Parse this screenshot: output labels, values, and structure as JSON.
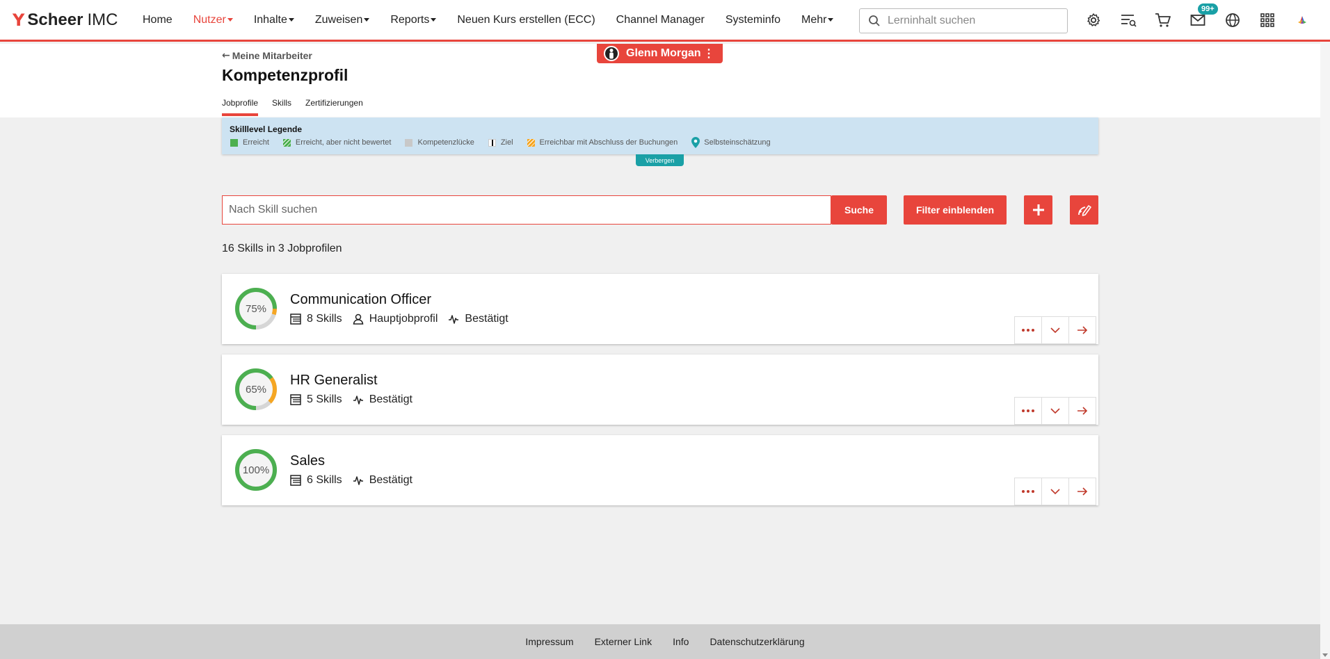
{
  "brand": {
    "mark": "Y",
    "name": "Scheer",
    "suffix": "IMC"
  },
  "nav": [
    {
      "label": "Home",
      "active": false,
      "dropdown": false
    },
    {
      "label": "Nutzer",
      "active": true,
      "dropdown": true
    },
    {
      "label": "Inhalte",
      "active": false,
      "dropdown": true
    },
    {
      "label": "Zuweisen",
      "active": false,
      "dropdown": true
    },
    {
      "label": "Reports",
      "active": false,
      "dropdown": true
    },
    {
      "label": "Neuen Kurs erstellen (ECC)",
      "active": false,
      "dropdown": false
    },
    {
      "label": "Channel Manager",
      "active": false,
      "dropdown": false
    },
    {
      "label": "Systeminfo",
      "active": false,
      "dropdown": false
    },
    {
      "label": "Mehr",
      "active": false,
      "dropdown": true
    }
  ],
  "top_search": {
    "placeholder": "Lerninhalt suchen",
    "value": ""
  },
  "top_icons": [
    "gear-icon",
    "learning-list-icon",
    "cart-icon",
    "mail-icon",
    "globe-icon",
    "apps-grid-icon",
    "colorful-logo-icon"
  ],
  "mail_badge": "99+",
  "header": {
    "back_label": "Meine Mitarbeiter",
    "title": "Kompetenzprofil",
    "tabs": [
      "Jobprofile",
      "Skills",
      "Zertifizierungen"
    ],
    "active_tab": 0,
    "user_name": "Glenn Morgan",
    "user_menu": "⋮"
  },
  "legend": {
    "title": "Skilllevel Legende",
    "items": [
      {
        "label": "Erreicht",
        "color": "#4caf50"
      },
      {
        "label": "Erreicht, aber nicht bewertet",
        "color": "#4caf50"
      },
      {
        "label": "Kompetenzlücke",
        "color": "#c8c8c8"
      },
      {
        "label": "Ziel",
        "color": "#111111"
      },
      {
        "label": "Erreichbar mit Abschluss der Buchungen",
        "color": "#f5a623"
      },
      {
        "label": "Selbsteinschätzung",
        "color": "#1aa0a6"
      }
    ],
    "hide_label": "Verbergen"
  },
  "skill_search": {
    "placeholder": "Nach Skill suchen",
    "value": "",
    "button": "Suche"
  },
  "filter_button": "Filter einblenden",
  "summary": "16 Skills in 3 Jobprofilen",
  "jobprofiles": [
    {
      "title": "Communication Officer",
      "percent": 75,
      "percent_label": "75%",
      "reachable_pct": 5,
      "skills": "8 Skills",
      "main_label": "Hauptjobprofil",
      "status": "Bestätigt"
    },
    {
      "title": "HR Generalist",
      "percent": 65,
      "percent_label": "65%",
      "reachable_pct": 22,
      "skills": "5 Skills",
      "main_label": "",
      "status": "Bestätigt"
    },
    {
      "title": "Sales",
      "percent": 100,
      "percent_label": "100%",
      "reachable_pct": 0,
      "skills": "6 Skills",
      "main_label": "",
      "status": "Bestätigt"
    }
  ],
  "footer": [
    "Impressum",
    "Externer Link",
    "Info",
    "Datenschutzerklärung"
  ],
  "colors": {
    "accent": "#e8453c",
    "teal": "#1aa0a6",
    "achieved": "#4caf50",
    "reachable": "#f5a623",
    "gap": "#d6d6d6",
    "legend_bg": "#cde3f2"
  }
}
